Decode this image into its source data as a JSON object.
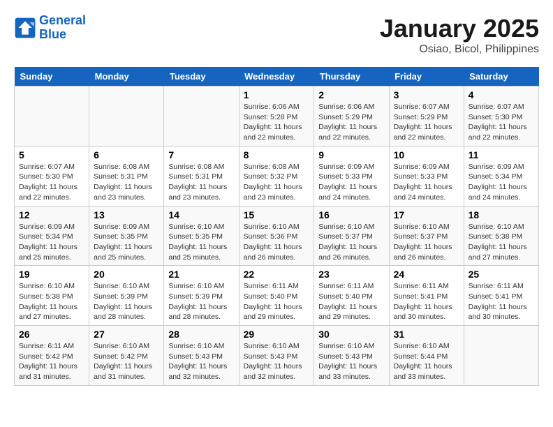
{
  "header": {
    "logo_line1": "General",
    "logo_line2": "Blue",
    "title": "January 2025",
    "subtitle": "Osiao, Bicol, Philippines"
  },
  "days_of_week": [
    "Sunday",
    "Monday",
    "Tuesday",
    "Wednesday",
    "Thursday",
    "Friday",
    "Saturday"
  ],
  "weeks": [
    [
      {
        "day": "",
        "info": ""
      },
      {
        "day": "",
        "info": ""
      },
      {
        "day": "",
        "info": ""
      },
      {
        "day": "1",
        "info": "Sunrise: 6:06 AM\nSunset: 5:28 PM\nDaylight: 11 hours and 22 minutes."
      },
      {
        "day": "2",
        "info": "Sunrise: 6:06 AM\nSunset: 5:29 PM\nDaylight: 11 hours and 22 minutes."
      },
      {
        "day": "3",
        "info": "Sunrise: 6:07 AM\nSunset: 5:29 PM\nDaylight: 11 hours and 22 minutes."
      },
      {
        "day": "4",
        "info": "Sunrise: 6:07 AM\nSunset: 5:30 PM\nDaylight: 11 hours and 22 minutes."
      }
    ],
    [
      {
        "day": "5",
        "info": "Sunrise: 6:07 AM\nSunset: 5:30 PM\nDaylight: 11 hours and 22 minutes."
      },
      {
        "day": "6",
        "info": "Sunrise: 6:08 AM\nSunset: 5:31 PM\nDaylight: 11 hours and 23 minutes."
      },
      {
        "day": "7",
        "info": "Sunrise: 6:08 AM\nSunset: 5:31 PM\nDaylight: 11 hours and 23 minutes."
      },
      {
        "day": "8",
        "info": "Sunrise: 6:08 AM\nSunset: 5:32 PM\nDaylight: 11 hours and 23 minutes."
      },
      {
        "day": "9",
        "info": "Sunrise: 6:09 AM\nSunset: 5:33 PM\nDaylight: 11 hours and 24 minutes."
      },
      {
        "day": "10",
        "info": "Sunrise: 6:09 AM\nSunset: 5:33 PM\nDaylight: 11 hours and 24 minutes."
      },
      {
        "day": "11",
        "info": "Sunrise: 6:09 AM\nSunset: 5:34 PM\nDaylight: 11 hours and 24 minutes."
      }
    ],
    [
      {
        "day": "12",
        "info": "Sunrise: 6:09 AM\nSunset: 5:34 PM\nDaylight: 11 hours and 25 minutes."
      },
      {
        "day": "13",
        "info": "Sunrise: 6:09 AM\nSunset: 5:35 PM\nDaylight: 11 hours and 25 minutes."
      },
      {
        "day": "14",
        "info": "Sunrise: 6:10 AM\nSunset: 5:35 PM\nDaylight: 11 hours and 25 minutes."
      },
      {
        "day": "15",
        "info": "Sunrise: 6:10 AM\nSunset: 5:36 PM\nDaylight: 11 hours and 26 minutes."
      },
      {
        "day": "16",
        "info": "Sunrise: 6:10 AM\nSunset: 5:37 PM\nDaylight: 11 hours and 26 minutes."
      },
      {
        "day": "17",
        "info": "Sunrise: 6:10 AM\nSunset: 5:37 PM\nDaylight: 11 hours and 26 minutes."
      },
      {
        "day": "18",
        "info": "Sunrise: 6:10 AM\nSunset: 5:38 PM\nDaylight: 11 hours and 27 minutes."
      }
    ],
    [
      {
        "day": "19",
        "info": "Sunrise: 6:10 AM\nSunset: 5:38 PM\nDaylight: 11 hours and 27 minutes."
      },
      {
        "day": "20",
        "info": "Sunrise: 6:10 AM\nSunset: 5:39 PM\nDaylight: 11 hours and 28 minutes."
      },
      {
        "day": "21",
        "info": "Sunrise: 6:10 AM\nSunset: 5:39 PM\nDaylight: 11 hours and 28 minutes."
      },
      {
        "day": "22",
        "info": "Sunrise: 6:11 AM\nSunset: 5:40 PM\nDaylight: 11 hours and 29 minutes."
      },
      {
        "day": "23",
        "info": "Sunrise: 6:11 AM\nSunset: 5:40 PM\nDaylight: 11 hours and 29 minutes."
      },
      {
        "day": "24",
        "info": "Sunrise: 6:11 AM\nSunset: 5:41 PM\nDaylight: 11 hours and 30 minutes."
      },
      {
        "day": "25",
        "info": "Sunrise: 6:11 AM\nSunset: 5:41 PM\nDaylight: 11 hours and 30 minutes."
      }
    ],
    [
      {
        "day": "26",
        "info": "Sunrise: 6:11 AM\nSunset: 5:42 PM\nDaylight: 11 hours and 31 minutes."
      },
      {
        "day": "27",
        "info": "Sunrise: 6:10 AM\nSunset: 5:42 PM\nDaylight: 11 hours and 31 minutes."
      },
      {
        "day": "28",
        "info": "Sunrise: 6:10 AM\nSunset: 5:43 PM\nDaylight: 11 hours and 32 minutes."
      },
      {
        "day": "29",
        "info": "Sunrise: 6:10 AM\nSunset: 5:43 PM\nDaylight: 11 hours and 32 minutes."
      },
      {
        "day": "30",
        "info": "Sunrise: 6:10 AM\nSunset: 5:43 PM\nDaylight: 11 hours and 33 minutes."
      },
      {
        "day": "31",
        "info": "Sunrise: 6:10 AM\nSunset: 5:44 PM\nDaylight: 11 hours and 33 minutes."
      },
      {
        "day": "",
        "info": ""
      }
    ]
  ]
}
